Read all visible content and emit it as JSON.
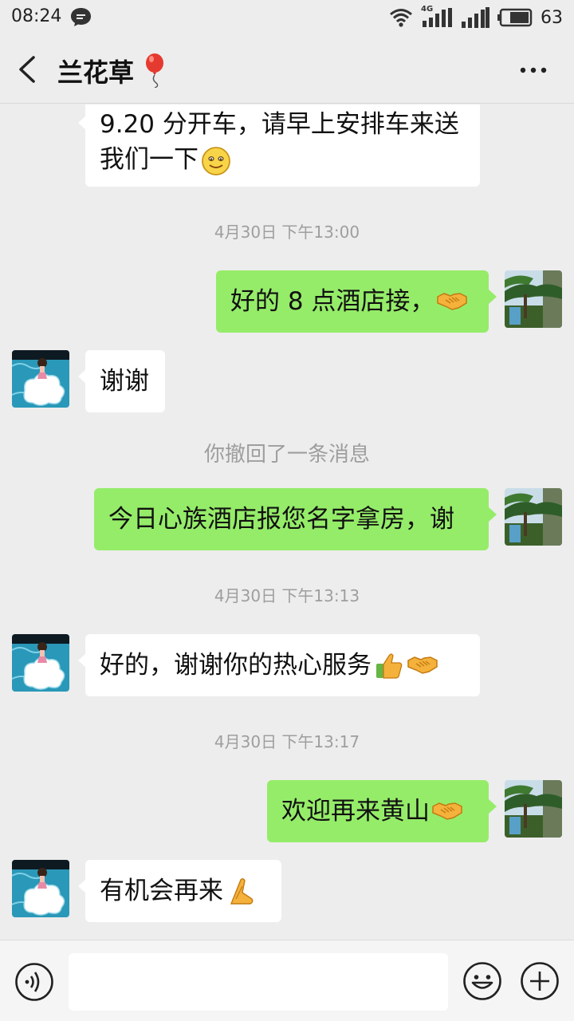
{
  "status_bar": {
    "time": "08:24",
    "network_label": "4G",
    "battery": "63",
    "icons": [
      "message-icon",
      "wifi-icon",
      "signal-icon",
      "battery-icon"
    ]
  },
  "header": {
    "title": "兰花草",
    "title_emoji": "balloon-icon",
    "icons": [
      "back-icon",
      "more-icon"
    ]
  },
  "messages": [
    {
      "type": "received",
      "lines": [
        "9.20 分开车，请早上安排车来送",
        "我们一下"
      ],
      "emoji": [
        "smile-emoji"
      ]
    },
    {
      "type": "timestamp",
      "text": "4月30日 下午13:00"
    },
    {
      "type": "sent",
      "text": "好的 8 点酒店接，",
      "emoji": [
        "handshake-emoji"
      ]
    },
    {
      "type": "received",
      "text": "谢谢"
    },
    {
      "type": "system",
      "text": "你撤回了一条消息"
    },
    {
      "type": "sent",
      "text": "今日心族酒店报您名字拿房，谢"
    },
    {
      "type": "timestamp",
      "text": "4月30日 下午13:13"
    },
    {
      "type": "received",
      "text": "好的，谢谢你的热心服务",
      "emoji": [
        "thumbs-up-emoji",
        "handshake-emoji"
      ]
    },
    {
      "type": "timestamp",
      "text": "4月30日 下午13:17"
    },
    {
      "type": "sent",
      "text": "欢迎再来黄山",
      "emoji": [
        "handshake-emoji"
      ]
    },
    {
      "type": "received",
      "text": "有机会再来",
      "emoji": [
        "praying-hands-emoji"
      ]
    }
  ],
  "input_bar": {
    "value": "",
    "icons": [
      "voice-icon",
      "emoji-icon",
      "plus-icon"
    ]
  },
  "colors": {
    "background": "#ededed",
    "sent_bubble": "#95ec69",
    "received_bubble": "#ffffff",
    "timestamp_text": "#9e9e9e"
  }
}
